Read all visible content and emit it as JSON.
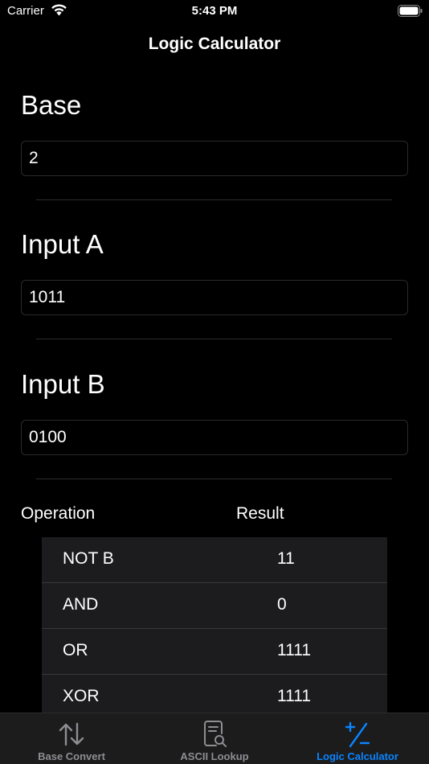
{
  "status_bar": {
    "carrier": "Carrier",
    "time": "5:43 PM"
  },
  "nav": {
    "title": "Logic Calculator"
  },
  "base": {
    "label": "Base",
    "value": "2"
  },
  "input_a": {
    "label": "Input A",
    "value": "1011"
  },
  "input_b": {
    "label": "Input B",
    "value": "0100"
  },
  "table": {
    "headers": [
      "Operation",
      "Result"
    ],
    "rows": [
      {
        "operation": "NOT B",
        "result": "11"
      },
      {
        "operation": "AND",
        "result": "0"
      },
      {
        "operation": "OR",
        "result": "1111"
      },
      {
        "operation": "XOR",
        "result": "1111"
      }
    ]
  },
  "tabs": [
    {
      "label": "Base Convert",
      "icon": "up-down-arrows-icon",
      "active": false
    },
    {
      "label": "ASCII Lookup",
      "icon": "document-search-icon",
      "active": false
    },
    {
      "label": "Logic Calculator",
      "icon": "plus-minus-icon",
      "active": true
    }
  ],
  "colors": {
    "accent": "#0a84ff",
    "inactive": "#8e8e93",
    "background": "#000000",
    "table_bg": "#1c1c1e"
  }
}
